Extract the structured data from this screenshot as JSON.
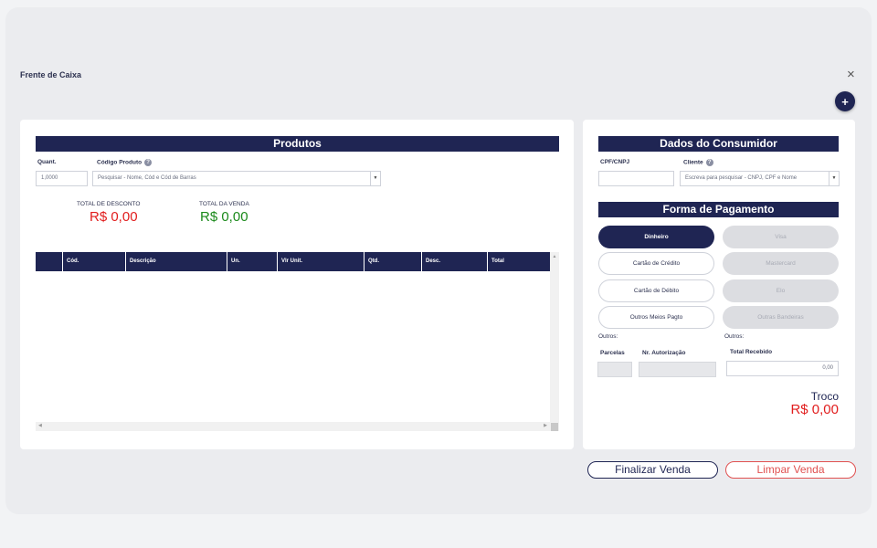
{
  "page": {
    "title": "Frente de Caixa",
    "close_icon": "×",
    "add_icon": "+"
  },
  "produtos": {
    "header": "Produtos",
    "quant_label": "Quant.",
    "quant_value": "1,0000",
    "codigo_label": "Código Produto",
    "codigo_placeholder": "Pesquisar - Nome, Cód e Cód de Barras",
    "total_desconto_label": "TOTAL DE DESCONTO",
    "total_desconto_value": "R$ 0,00",
    "total_venda_label": "TOTAL DA VENDA",
    "total_venda_value": "R$ 0,00",
    "columns": [
      "Cód.",
      "Descrição",
      "Un.",
      "Vlr Unit.",
      "Qtd.",
      "Desc.",
      "Total"
    ]
  },
  "consumidor": {
    "header": "Dados do Consumidor",
    "cpf_label": "CPF/CNPJ",
    "cpf_value": "",
    "cliente_label": "Cliente",
    "cliente_placeholder": "Escreva para pesquisar - CNPJ, CPF e Nome"
  },
  "pagamento": {
    "header": "Forma de Pagamento",
    "dinheiro": "Dinheiro",
    "visa": "Visa",
    "credito": "Cartão de Crédito",
    "mastercard": "Mastercard",
    "debito": "Cartão de Débito",
    "elo": "Elo",
    "outros_meios": "Outros Meios Pagto",
    "outras_bandeiras": "Outras Bandeiras",
    "outros_left": "Outros:",
    "outros_right": "Outros:",
    "parcelas_label": "Parcelas",
    "autorizacao_label": "Nr. Autorização",
    "total_recebido_label": "Total Recebido",
    "total_recebido_value": "0,00",
    "troco_label": "Troco",
    "troco_value": "R$ 0,00"
  },
  "actions": {
    "finalizar": "Finalizar Venda",
    "limpar": "Limpar Venda"
  },
  "colors": {
    "navy": "#1f2553",
    "red": "#e11d1d",
    "green": "#1c8a1c"
  }
}
